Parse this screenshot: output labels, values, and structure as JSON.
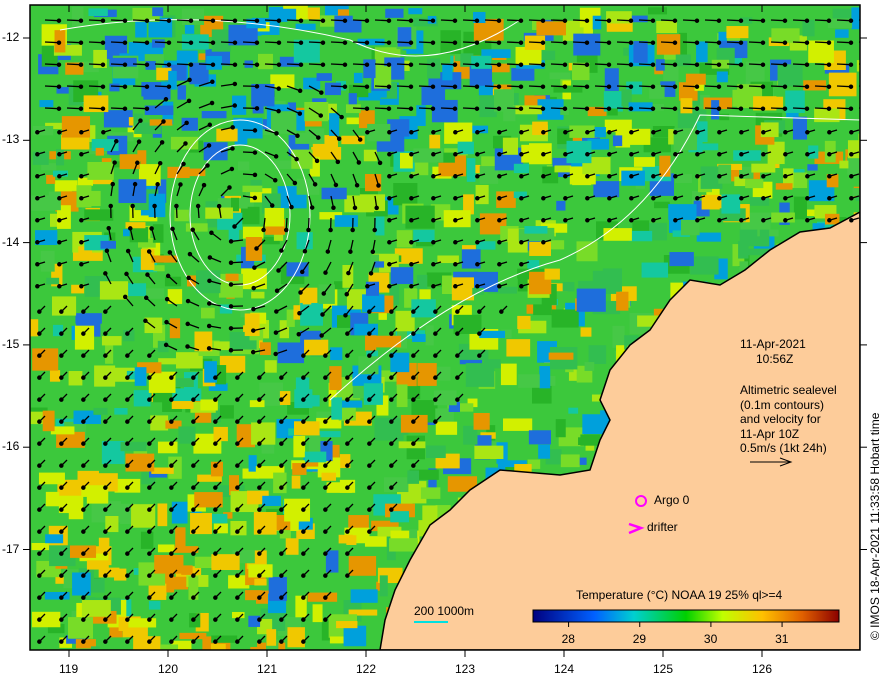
{
  "map": {
    "lon_ticks": [
      "119",
      "120",
      "121",
      "122",
      "123",
      "124",
      "125",
      "126"
    ],
    "lat_ticks": [
      "-12",
      "-13",
      "-14",
      "-15",
      "-16",
      "-17"
    ],
    "land_color": "#fdcc9a",
    "contour_color": "#ffffff"
  },
  "annotations": {
    "date": "11-Apr-2021",
    "time": "10:56Z",
    "legend_lines": [
      "Altimetric sealevel",
      "(0.1m contours)",
      "and velocity for",
      "11-Apr 10Z",
      "0.5m/s (1kt 24h)"
    ],
    "argo": "Argo 0",
    "drifter": "drifter",
    "bathy": "200  1000m",
    "marker_color": "#ff00ff",
    "bathy_color": "#00e0e0"
  },
  "colorbar": {
    "title": "Temperature (°C) NOAA 19 25% ql>=4",
    "ticks": [
      "28",
      "29",
      "30",
      "31"
    ],
    "range": [
      27.5,
      31.8
    ]
  },
  "credit": "© IMOS 18-Apr-2021 11:33:58 Hobart time"
}
